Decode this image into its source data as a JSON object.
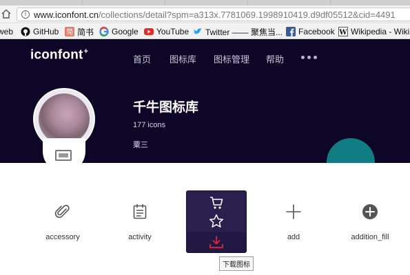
{
  "browser": {
    "url_host": "www.iconfont.cn",
    "url_path": "/collections/detail?spm=a313x.7781069.1998910419.d9df05512&cid=4491",
    "bookmarks": [
      {
        "label": "web",
        "icon": "web-icon"
      },
      {
        "label": "GitHub",
        "icon": "github-icon"
      },
      {
        "label": "简书",
        "icon": "jianshu-icon"
      },
      {
        "label": "Google",
        "icon": "google-icon"
      },
      {
        "label": "YouTube",
        "icon": "youtube-icon"
      },
      {
        "label": "Twitter —— 聚焦当...",
        "icon": "twitter-icon"
      },
      {
        "label": "Facebook",
        "icon": "facebook-icon"
      },
      {
        "label": "Wikipedia - Wikip",
        "icon": "wikipedia-icon"
      }
    ]
  },
  "site": {
    "logo": "iconfont",
    "logo_mark": "+",
    "nav": [
      "首页",
      "图标库",
      "图标管理",
      "帮助"
    ]
  },
  "collection": {
    "title": "千牛图标库",
    "count": "177 icons",
    "owner": "粟三"
  },
  "icons": [
    {
      "label": "accessory",
      "icon": "paperclip-icon"
    },
    {
      "label": "activity",
      "icon": "clipboard-icon"
    },
    {
      "label": "",
      "icon": "hovered-icon"
    },
    {
      "label": "add",
      "icon": "plus-icon"
    },
    {
      "label": "addition_fill",
      "icon": "plus-circle-fill-icon"
    }
  ],
  "hover_actions": [
    "cart-icon",
    "star-icon",
    "download-icon"
  ],
  "tooltip": "下载图标",
  "colors": {
    "hero_bg": "#0d0627",
    "hover_card": "#2b1f4d",
    "download_accent": "#e5243a",
    "teal_deco": "#0f7d83"
  }
}
